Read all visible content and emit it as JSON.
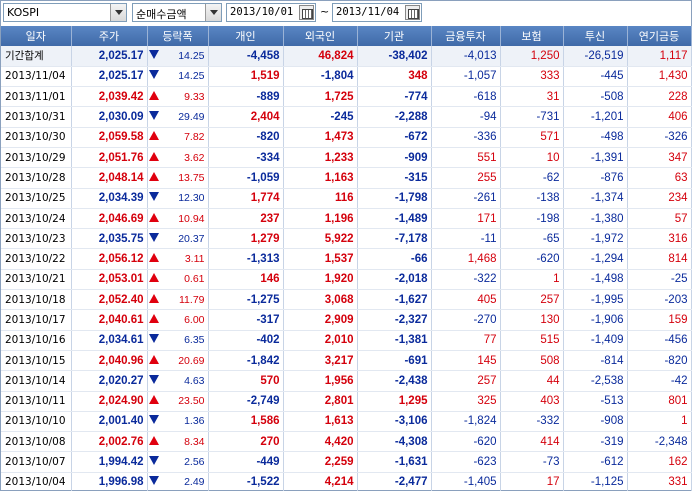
{
  "toolbar": {
    "market": "KOSPI",
    "metric": "순매수금액",
    "start_date": "2013/10/01",
    "separator": "~",
    "end_date": "2013/11/04"
  },
  "colors": {
    "up": "#d4000c",
    "down": "#0a2a9b",
    "header": "#4a76b6"
  },
  "headers": [
    "일자",
    "주가",
    "등락폭",
    "개인",
    "외국인",
    "기관",
    "금융투자",
    "보험",
    "투신",
    "연기금등"
  ],
  "rows": [
    {
      "date": "기간합계",
      "price": "2,025.17",
      "dir": "dn",
      "chg": "14.25",
      "ind": "-4,458",
      "frn": "46,824",
      "inst": "-38,402",
      "fin": "-4,013",
      "ins": "1,250",
      "trust": "-26,519",
      "pen": "1,117",
      "total": true
    },
    {
      "date": "2013/11/04",
      "price": "2,025.17",
      "dir": "dn",
      "chg": "14.25",
      "ind": "1,519",
      "frn": "-1,804",
      "inst": "348",
      "fin": "-1,057",
      "ins": "333",
      "trust": "-445",
      "pen": "1,430"
    },
    {
      "date": "2013/11/01",
      "price": "2,039.42",
      "dir": "up",
      "chg": "9.33",
      "ind": "-889",
      "frn": "1,725",
      "inst": "-774",
      "fin": "-618",
      "ins": "31",
      "trust": "-508",
      "pen": "228"
    },
    {
      "date": "2013/10/31",
      "price": "2,030.09",
      "dir": "dn",
      "chg": "29.49",
      "ind": "2,404",
      "frn": "-245",
      "inst": "-2,288",
      "fin": "-94",
      "ins": "-731",
      "trust": "-1,201",
      "pen": "406"
    },
    {
      "date": "2013/10/30",
      "price": "2,059.58",
      "dir": "up",
      "chg": "7.82",
      "ind": "-820",
      "frn": "1,473",
      "inst": "-672",
      "fin": "-336",
      "ins": "571",
      "trust": "-498",
      "pen": "-326"
    },
    {
      "date": "2013/10/29",
      "price": "2,051.76",
      "dir": "up",
      "chg": "3.62",
      "ind": "-334",
      "frn": "1,233",
      "inst": "-909",
      "fin": "551",
      "ins": "10",
      "trust": "-1,391",
      "pen": "347"
    },
    {
      "date": "2013/10/28",
      "price": "2,048.14",
      "dir": "up",
      "chg": "13.75",
      "ind": "-1,059",
      "frn": "1,163",
      "inst": "-315",
      "fin": "255",
      "ins": "-62",
      "trust": "-876",
      "pen": "63"
    },
    {
      "date": "2013/10/25",
      "price": "2,034.39",
      "dir": "dn",
      "chg": "12.30",
      "ind": "1,774",
      "frn": "116",
      "inst": "-1,798",
      "fin": "-261",
      "ins": "-138",
      "trust": "-1,374",
      "pen": "234"
    },
    {
      "date": "2013/10/24",
      "price": "2,046.69",
      "dir": "up",
      "chg": "10.94",
      "ind": "237",
      "frn": "1,196",
      "inst": "-1,489",
      "fin": "171",
      "ins": "-198",
      "trust": "-1,380",
      "pen": "57"
    },
    {
      "date": "2013/10/23",
      "price": "2,035.75",
      "dir": "dn",
      "chg": "20.37",
      "ind": "1,279",
      "frn": "5,922",
      "inst": "-7,178",
      "fin": "-11",
      "ins": "-65",
      "trust": "-1,972",
      "pen": "316"
    },
    {
      "date": "2013/10/22",
      "price": "2,056.12",
      "dir": "up",
      "chg": "3.11",
      "ind": "-1,313",
      "frn": "1,537",
      "inst": "-66",
      "fin": "1,468",
      "ins": "-620",
      "trust": "-1,294",
      "pen": "814"
    },
    {
      "date": "2013/10/21",
      "price": "2,053.01",
      "dir": "up",
      "chg": "0.61",
      "ind": "146",
      "frn": "1,920",
      "inst": "-2,018",
      "fin": "-322",
      "ins": "1",
      "trust": "-1,498",
      "pen": "-25"
    },
    {
      "date": "2013/10/18",
      "price": "2,052.40",
      "dir": "up",
      "chg": "11.79",
      "ind": "-1,275",
      "frn": "3,068",
      "inst": "-1,627",
      "fin": "405",
      "ins": "257",
      "trust": "-1,995",
      "pen": "-203"
    },
    {
      "date": "2013/10/17",
      "price": "2,040.61",
      "dir": "up",
      "chg": "6.00",
      "ind": "-317",
      "frn": "2,909",
      "inst": "-2,327",
      "fin": "-270",
      "ins": "130",
      "trust": "-1,906",
      "pen": "159"
    },
    {
      "date": "2013/10/16",
      "price": "2,034.61",
      "dir": "dn",
      "chg": "6.35",
      "ind": "-402",
      "frn": "2,010",
      "inst": "-1,381",
      "fin": "77",
      "ins": "515",
      "trust": "-1,409",
      "pen": "-456"
    },
    {
      "date": "2013/10/15",
      "price": "2,040.96",
      "dir": "up",
      "chg": "20.69",
      "ind": "-1,842",
      "frn": "3,217",
      "inst": "-691",
      "fin": "145",
      "ins": "508",
      "trust": "-814",
      "pen": "-820"
    },
    {
      "date": "2013/10/14",
      "price": "2,020.27",
      "dir": "dn",
      "chg": "4.63",
      "ind": "570",
      "frn": "1,956",
      "inst": "-2,438",
      "fin": "257",
      "ins": "44",
      "trust": "-2,538",
      "pen": "-42"
    },
    {
      "date": "2013/10/11",
      "price": "2,024.90",
      "dir": "up",
      "chg": "23.50",
      "ind": "-2,749",
      "frn": "2,801",
      "inst": "1,295",
      "fin": "325",
      "ins": "403",
      "trust": "-513",
      "pen": "801"
    },
    {
      "date": "2013/10/10",
      "price": "2,001.40",
      "dir": "dn",
      "chg": "1.36",
      "ind": "1,586",
      "frn": "1,613",
      "inst": "-3,106",
      "fin": "-1,824",
      "ins": "-332",
      "trust": "-908",
      "pen": "1"
    },
    {
      "date": "2013/10/08",
      "price": "2,002.76",
      "dir": "up",
      "chg": "8.34",
      "ind": "270",
      "frn": "4,420",
      "inst": "-4,308",
      "fin": "-620",
      "ins": "414",
      "trust": "-319",
      "pen": "-2,348"
    },
    {
      "date": "2013/10/07",
      "price": "1,994.42",
      "dir": "dn",
      "chg": "2.56",
      "ind": "-449",
      "frn": "2,259",
      "inst": "-1,631",
      "fin": "-623",
      "ins": "-73",
      "trust": "-612",
      "pen": "162"
    },
    {
      "date": "2013/10/04",
      "price": "1,996.98",
      "dir": "dn",
      "chg": "2.49",
      "ind": "-1,522",
      "frn": "4,214",
      "inst": "-2,477",
      "fin": "-1,405",
      "ins": "17",
      "trust": "-1,125",
      "pen": "331"
    }
  ]
}
